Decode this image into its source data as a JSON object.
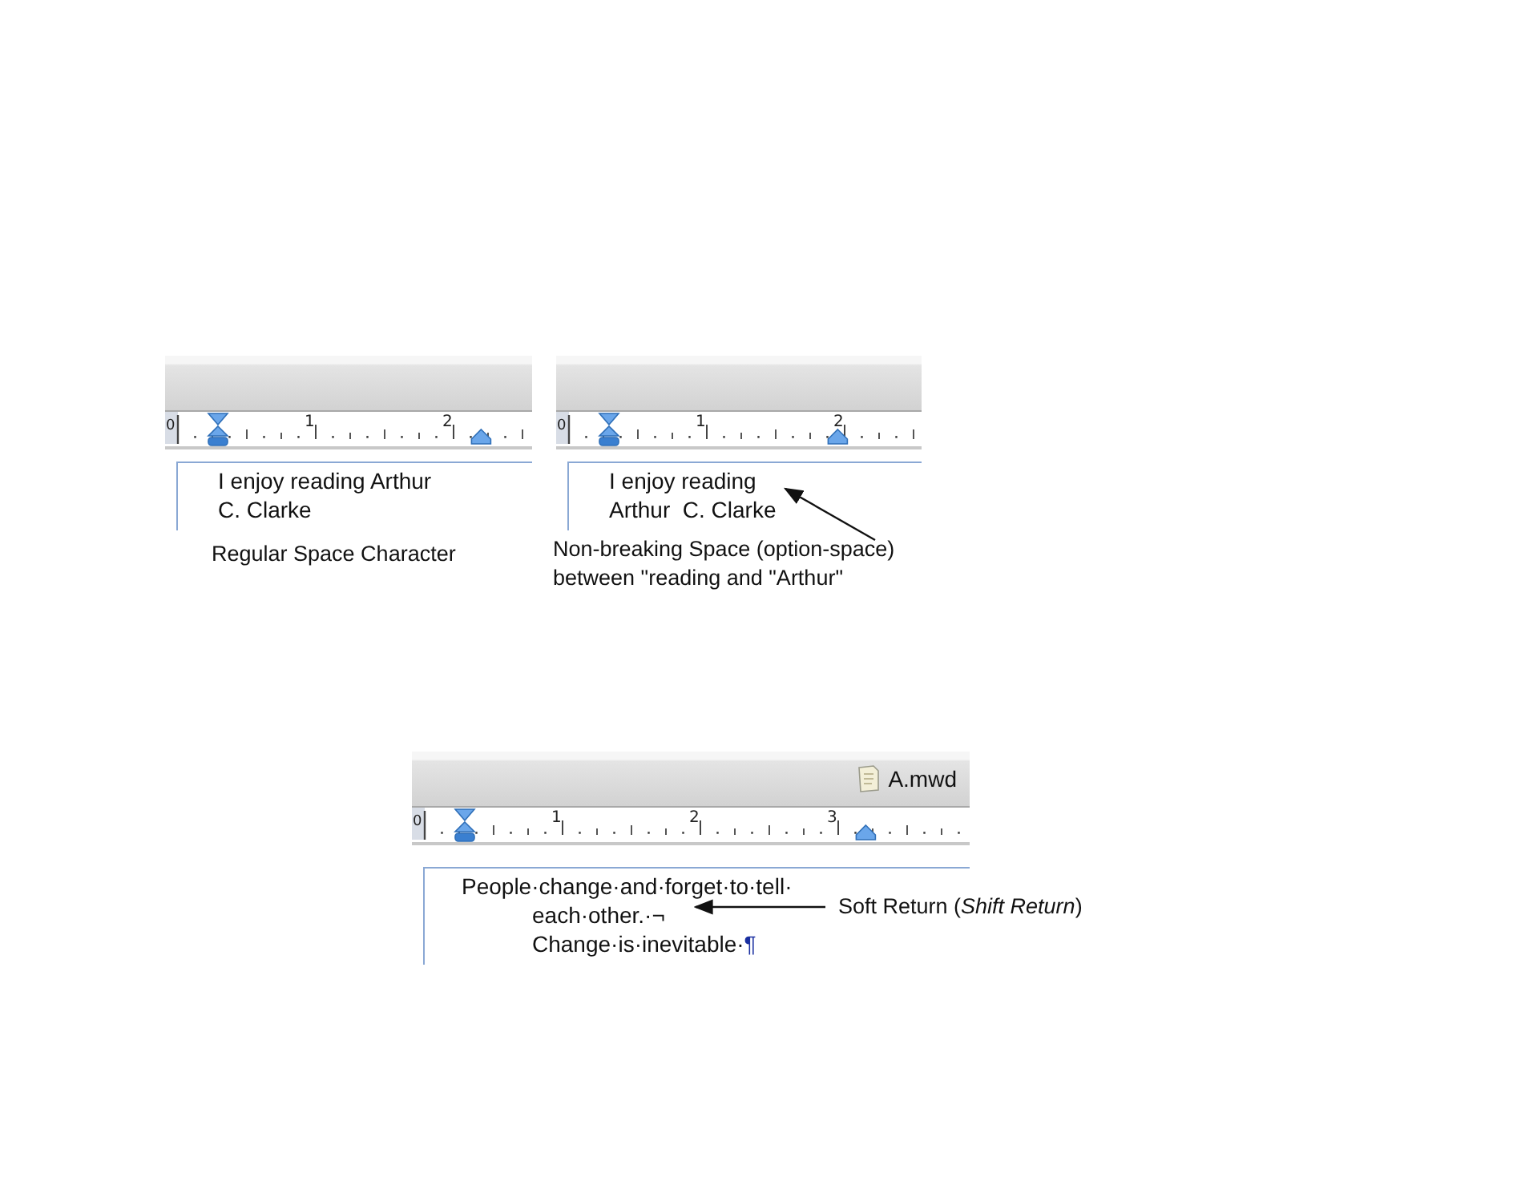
{
  "panels": [
    {
      "ruler": {
        "numbers": [
          "0",
          "1",
          "2"
        ]
      },
      "lines": [
        {
          "text": "I enjoy reading Arthur"
        },
        {
          "text": "C. Clarke"
        }
      ],
      "caption": [
        "Regular Space Character"
      ]
    },
    {
      "ruler": {
        "numbers": [
          "0",
          "1",
          "2"
        ]
      },
      "lines": [
        {
          "text": "I enjoy reading"
        },
        {
          "text": "Arthur  C. Clarke"
        }
      ],
      "caption": [
        "Non-breaking Space (option-space)",
        "between \"reading and \"Arthur\""
      ]
    },
    {
      "file": {
        "name": "A.mwd"
      },
      "ruler": {
        "numbers": [
          "0",
          "1",
          "2",
          "3"
        ]
      },
      "lines": [
        {
          "text": "People·change·and·forget·to·tell·",
          "kind": "first"
        },
        {
          "text": "each·other.·",
          "symbol": {
            "char": "¬",
            "kind": "line-break"
          },
          "kind": "continuation"
        },
        {
          "text": "Change·is·inevitable·",
          "symbol": {
            "char": "¶",
            "kind": "paragraph"
          },
          "kind": "continuation"
        }
      ],
      "side_note": [
        "Soft Return (*Shift Return*)"
      ]
    }
  ]
}
